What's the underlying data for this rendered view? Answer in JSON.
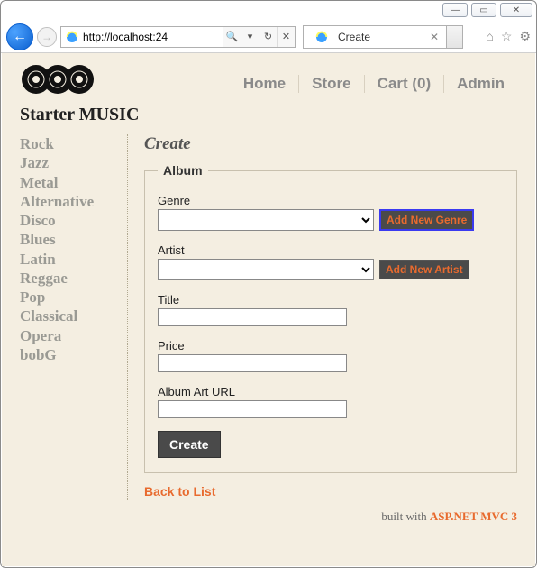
{
  "window": {
    "minimize_glyph": "—",
    "maximize_glyph": "▭",
    "close_glyph": "✕"
  },
  "browser": {
    "back_glyph": "←",
    "forward_glyph": "→",
    "url": "http://localhost:24",
    "search_glyph": "🔍",
    "dropdown_glyph": "▾",
    "refresh_glyph": "↻",
    "stop_glyph": "✕",
    "tab_title": "Create",
    "tab_close_glyph": "✕",
    "home_glyph": "⌂",
    "fav_glyph": "☆",
    "gear_glyph": "⚙"
  },
  "site": {
    "title": "Starter MUSIC",
    "nav": {
      "home": "Home",
      "store": "Store",
      "cart": "Cart (0)",
      "admin": "Admin"
    }
  },
  "sidebar": {
    "items": [
      "Rock",
      "Jazz",
      "Metal",
      "Alternative",
      "Disco",
      "Blues",
      "Latin",
      "Reggae",
      "Pop",
      "Classical",
      "Opera",
      "bobG"
    ]
  },
  "page": {
    "heading": "Create",
    "legend": "Album",
    "genre_label": "Genre",
    "genre_value": "",
    "add_genre": "Add New Genre",
    "artist_label": "Artist",
    "artist_value": "",
    "add_artist": "Add New Artist",
    "title_label": "Title",
    "title_value": "",
    "price_label": "Price",
    "price_value": "",
    "arturl_label": "Album Art URL",
    "arturl_value": "",
    "submit": "Create",
    "back": "Back to List"
  },
  "footer": {
    "prefix": "built with ",
    "link": "ASP.NET MVC 3"
  }
}
